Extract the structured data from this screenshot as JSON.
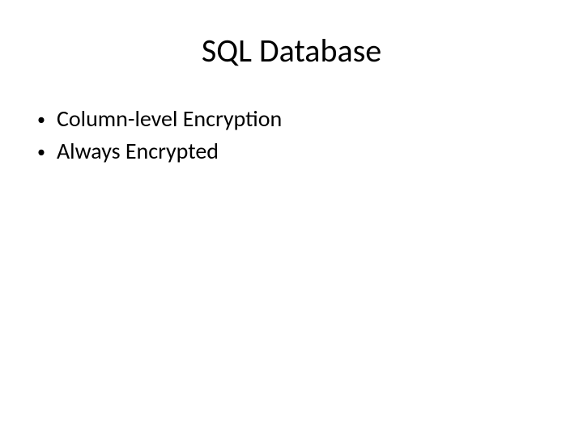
{
  "slide": {
    "title": "SQL Database",
    "bullets": [
      "Column-level Encryption",
      "Always Encrypted"
    ]
  }
}
